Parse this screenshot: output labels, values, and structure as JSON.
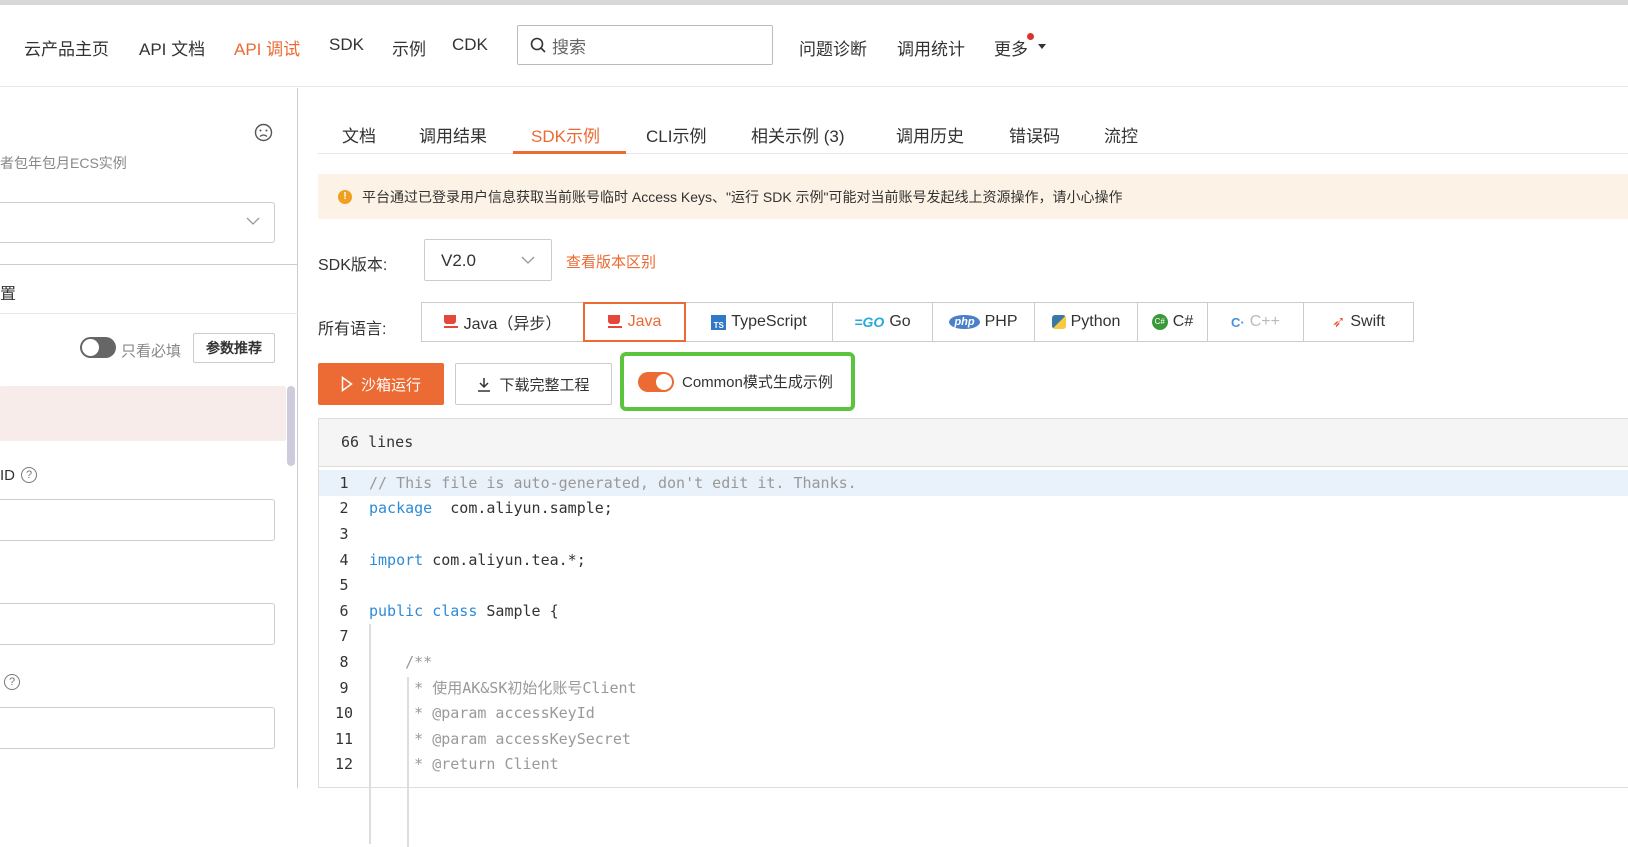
{
  "nav": {
    "items": [
      "云产品主页",
      "API 文档",
      "API 调试",
      "SDK",
      "示例",
      "CDK"
    ],
    "active": "API 调试",
    "search_placeholder": "搜索",
    "right_items": [
      "问题诊断",
      "调用统计",
      "更多"
    ]
  },
  "left": {
    "desc": "者包年包月ECS实例",
    "section": "置",
    "toggle_label": "只看必填",
    "recommend_button": "参数推荐",
    "field1_label": "ID",
    "colors": {
      "highlight": "#f7ece9"
    }
  },
  "tabs": [
    "文档",
    "调用结果",
    "SDK示例",
    "CLI示例",
    "相关示例 (3)",
    "调用历史",
    "错误码",
    "流控"
  ],
  "notice": "平台通过已登录用户信息获取当前账号临时 Access Keys、\"运行 SDK 示例\"可能对当前账号发起线上资源操作，请小心操作",
  "sdk": {
    "version_label": "SDK版本:",
    "version": "V2.0",
    "diff_link": "查看版本区别",
    "lang_label": "所有语言:",
    "languages": [
      {
        "name": "Java（异步）",
        "icon": "java-icon"
      },
      {
        "name": "Java",
        "icon": "java-icon",
        "active": true
      },
      {
        "name": "TypeScript",
        "icon": "ts-icon"
      },
      {
        "name": "Go",
        "icon": "go-icon"
      },
      {
        "name": "PHP",
        "icon": "php-icon"
      },
      {
        "name": "Python",
        "icon": "python-icon"
      },
      {
        "name": "C#",
        "icon": "csharp-icon"
      },
      {
        "name": "C++",
        "icon": "cpp-icon",
        "disabled": true
      },
      {
        "name": "Swift",
        "icon": "swift-icon"
      }
    ],
    "run_button": "沙箱运行",
    "download_button": "下载完整工程",
    "common_toggle": "Common模式生成示例"
  },
  "code": {
    "line_count": "66 lines",
    "lines": [
      {
        "n": "1",
        "parts": [
          [
            "cm",
            "// This file is auto-generated, don't edit it. Thanks."
          ]
        ]
      },
      {
        "n": "2",
        "parts": [
          [
            "kw",
            "package"
          ],
          [
            "",
            "  com.aliyun.sample;"
          ]
        ]
      },
      {
        "n": "3",
        "parts": []
      },
      {
        "n": "4",
        "parts": [
          [
            "kw",
            "import"
          ],
          [
            "",
            " com.aliyun.tea.*;"
          ]
        ]
      },
      {
        "n": "5",
        "parts": []
      },
      {
        "n": "6",
        "parts": [
          [
            "kw",
            "public class"
          ],
          [
            "",
            " Sample {"
          ]
        ]
      },
      {
        "n": "7",
        "parts": []
      },
      {
        "n": "8",
        "parts": [
          [
            "cm",
            "    /**"
          ]
        ]
      },
      {
        "n": "9",
        "parts": [
          [
            "cm",
            "     * 使用AK&SK初始化账号Client"
          ]
        ]
      },
      {
        "n": "10",
        "parts": [
          [
            "cm",
            "     * @param accessKeyId"
          ]
        ]
      },
      {
        "n": "11",
        "parts": [
          [
            "cm",
            "     * @param accessKeySecret"
          ]
        ]
      },
      {
        "n": "12",
        "parts": [
          [
            "cm",
            "     * @return Client"
          ]
        ]
      }
    ]
  },
  "colors": {
    "accent": "#ec6a33",
    "highlight_border": "#5cc43c"
  }
}
